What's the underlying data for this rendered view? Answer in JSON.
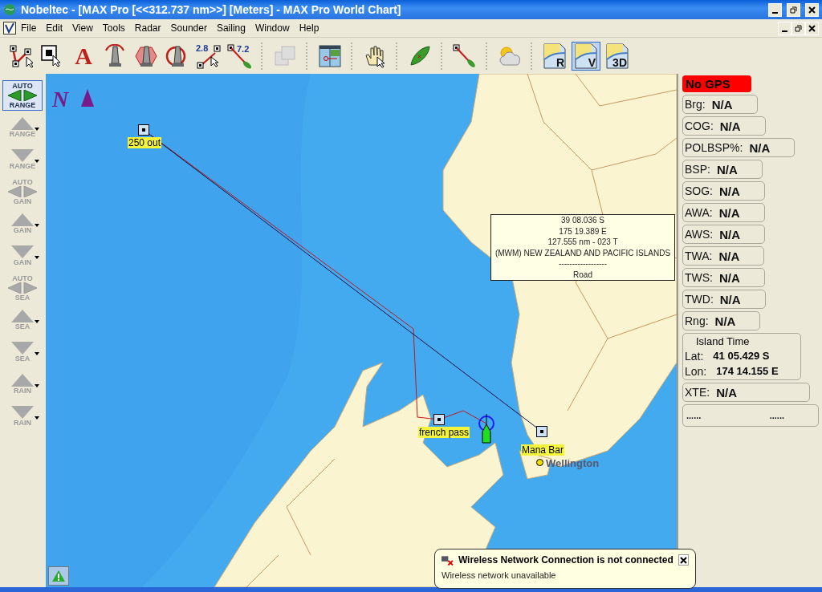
{
  "window": {
    "title": "Nobeltec - [MAX Pro [<<312.737 nm>>] [Meters] - MAX Pro World Chart]"
  },
  "menu": [
    "File",
    "Edit",
    "View",
    "Tools",
    "Radar",
    "Sounder",
    "Sailing",
    "Window",
    "Help"
  ],
  "toolbar": [
    [
      {
        "kind": "route",
        "selected": false
      },
      {
        "kind": "select",
        "selected": false
      },
      {
        "kind": "text",
        "label": "A",
        "selected": false
      },
      {
        "kind": "aid-ring",
        "selected": false
      },
      {
        "kind": "aid-hex",
        "selected": false
      },
      {
        "kind": "aid-circle",
        "selected": false
      },
      {
        "kind": "measure",
        "label": "2.8",
        "selected": false
      },
      {
        "kind": "bearing",
        "label": "7.2",
        "selected": false
      }
    ],
    [
      {
        "kind": "copy",
        "selected": false,
        "disabled": true
      }
    ],
    [
      {
        "kind": "split",
        "selected": false
      }
    ],
    [
      {
        "kind": "hand",
        "selected": false
      }
    ],
    [
      {
        "kind": "boat",
        "selected": false
      }
    ],
    [
      {
        "kind": "pin",
        "selected": false
      }
    ],
    [
      {
        "kind": "weather",
        "selected": false
      }
    ],
    [
      {
        "kind": "chart",
        "label": "R",
        "selected": false
      },
      {
        "kind": "chart",
        "label": "V",
        "selected": true
      },
      {
        "kind": "chart",
        "label": "3D",
        "selected": false
      }
    ]
  ],
  "radar_controls": [
    {
      "kind": "auto",
      "top": "AUTO",
      "label": "RANGE",
      "active": true
    },
    {
      "kind": "up",
      "label": "RANGE",
      "active": false
    },
    {
      "kind": "down",
      "label": "RANGE",
      "active": false
    },
    {
      "kind": "auto",
      "top": "AUTO",
      "label": "GAIN",
      "active": false
    },
    {
      "kind": "up",
      "label": "GAIN",
      "active": false
    },
    {
      "kind": "down",
      "label": "GAIN",
      "active": false
    },
    {
      "kind": "auto",
      "top": "AUTO",
      "label": "SEA",
      "active": false
    },
    {
      "kind": "up",
      "label": "SEA",
      "active": false
    },
    {
      "kind": "down",
      "label": "SEA",
      "active": false
    },
    {
      "kind": "up",
      "label": "RAIN",
      "active": false
    },
    {
      "kind": "down",
      "label": "RAIN",
      "active": false
    }
  ],
  "chart": {
    "north_label": "N",
    "waypoints": [
      {
        "label": "250 out"
      },
      {
        "label": "french pass"
      },
      {
        "label": "Mana Bar"
      }
    ],
    "city": {
      "label": "Wellington"
    },
    "info": {
      "lines": [
        "39 08.036 S",
        "175 19.389 E",
        "127.555 nm - 023 T",
        "(MWM) NEW ZEALAND AND PACIFIC ISLANDS",
        "------------------",
        "Road"
      ]
    }
  },
  "instruments": {
    "gps_status": "No GPS",
    "readouts": [
      {
        "label": "Brg:",
        "value": "N/A"
      },
      {
        "label": "COG:",
        "value": "N/A"
      },
      {
        "label": "POLBSP%:",
        "value": "N/A"
      },
      {
        "label": "BSP:",
        "value": "N/A"
      },
      {
        "label": "SOG:",
        "value": "N/A"
      },
      {
        "label": "AWA:",
        "value": "N/A"
      },
      {
        "label": "AWS:",
        "value": "N/A"
      },
      {
        "label": "TWA:",
        "value": "N/A"
      },
      {
        "label": "TWS:",
        "value": "N/A"
      },
      {
        "label": "TWD:",
        "value": "N/A"
      },
      {
        "label": "Rng:",
        "value": "N/A"
      }
    ],
    "position": {
      "title": "Island Time",
      "lat_label": "Lat:",
      "lat": "41 05.429 S",
      "lon_label": "Lon:",
      "lon": "174 14.155 E"
    },
    "xte": {
      "label": "XTE:",
      "value": "N/A"
    },
    "extra": [
      "......",
      "......"
    ]
  },
  "notification": {
    "title": "Wireless Network Connection is not connected",
    "message": "Wireless network unavailable"
  }
}
